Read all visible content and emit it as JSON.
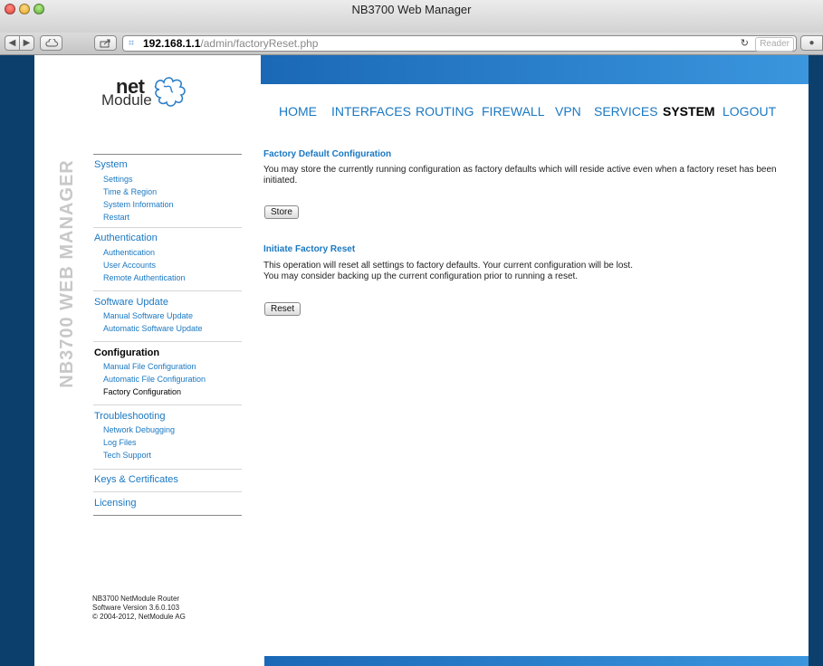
{
  "window": {
    "title": "NB3700 Web Manager"
  },
  "address_bar": {
    "host": "192.168.1.1",
    "path": "/admin/factoryReset.php",
    "reader_label": "Reader"
  },
  "logo": {
    "word1": "net",
    "word2": "Module"
  },
  "brand_vertical": "NB3700 WEB MANAGER",
  "nav": [
    {
      "label": "HOME"
    },
    {
      "label": "INTERFACES"
    },
    {
      "label": "ROUTING"
    },
    {
      "label": "FIREWALL"
    },
    {
      "label": "VPN"
    },
    {
      "label": "SERVICES"
    },
    {
      "label": "SYSTEM"
    },
    {
      "label": "LOGOUT"
    }
  ],
  "sidebar": {
    "system": {
      "label": "System",
      "items": [
        "Settings",
        "Time & Region",
        "System Information",
        "Restart"
      ]
    },
    "authentication": {
      "label": "Authentication",
      "items": [
        "Authentication",
        "User Accounts",
        "Remote Authentication"
      ]
    },
    "software_update": {
      "label": "Software Update",
      "items": [
        "Manual Software Update",
        "Automatic Software Update"
      ]
    },
    "configuration": {
      "label": "Configuration",
      "items": [
        "Manual File Configuration",
        "Automatic File Configuration",
        "Factory Configuration"
      ]
    },
    "troubleshooting": {
      "label": "Troubleshooting",
      "items": [
        "Network Debugging",
        "Log Files",
        "Tech Support"
      ]
    },
    "keys": {
      "label": "Keys & Certificates"
    },
    "licensing": {
      "label": "Licensing"
    }
  },
  "footer": {
    "line1": "NB3700 NetModule Router",
    "line2": "Software Version 3.6.0.103",
    "line3": "© 2004-2012, NetModule AG"
  },
  "content": {
    "factory_default": {
      "heading": "Factory Default Configuration",
      "text": "You may store the currently running configuration as factory defaults which will reside active even when a factory reset has been initiated.",
      "button": "Store"
    },
    "initiate_reset": {
      "heading": "Initiate Factory Reset",
      "line1": "This operation will reset all settings to factory defaults. Your current configuration will be lost.",
      "line2": "You may consider backing up the current configuration prior to running a reset.",
      "button": "Reset"
    }
  },
  "colors": {
    "link": "#1a78c2",
    "frame": "#0c3f6c",
    "band": "#2a80cc"
  }
}
